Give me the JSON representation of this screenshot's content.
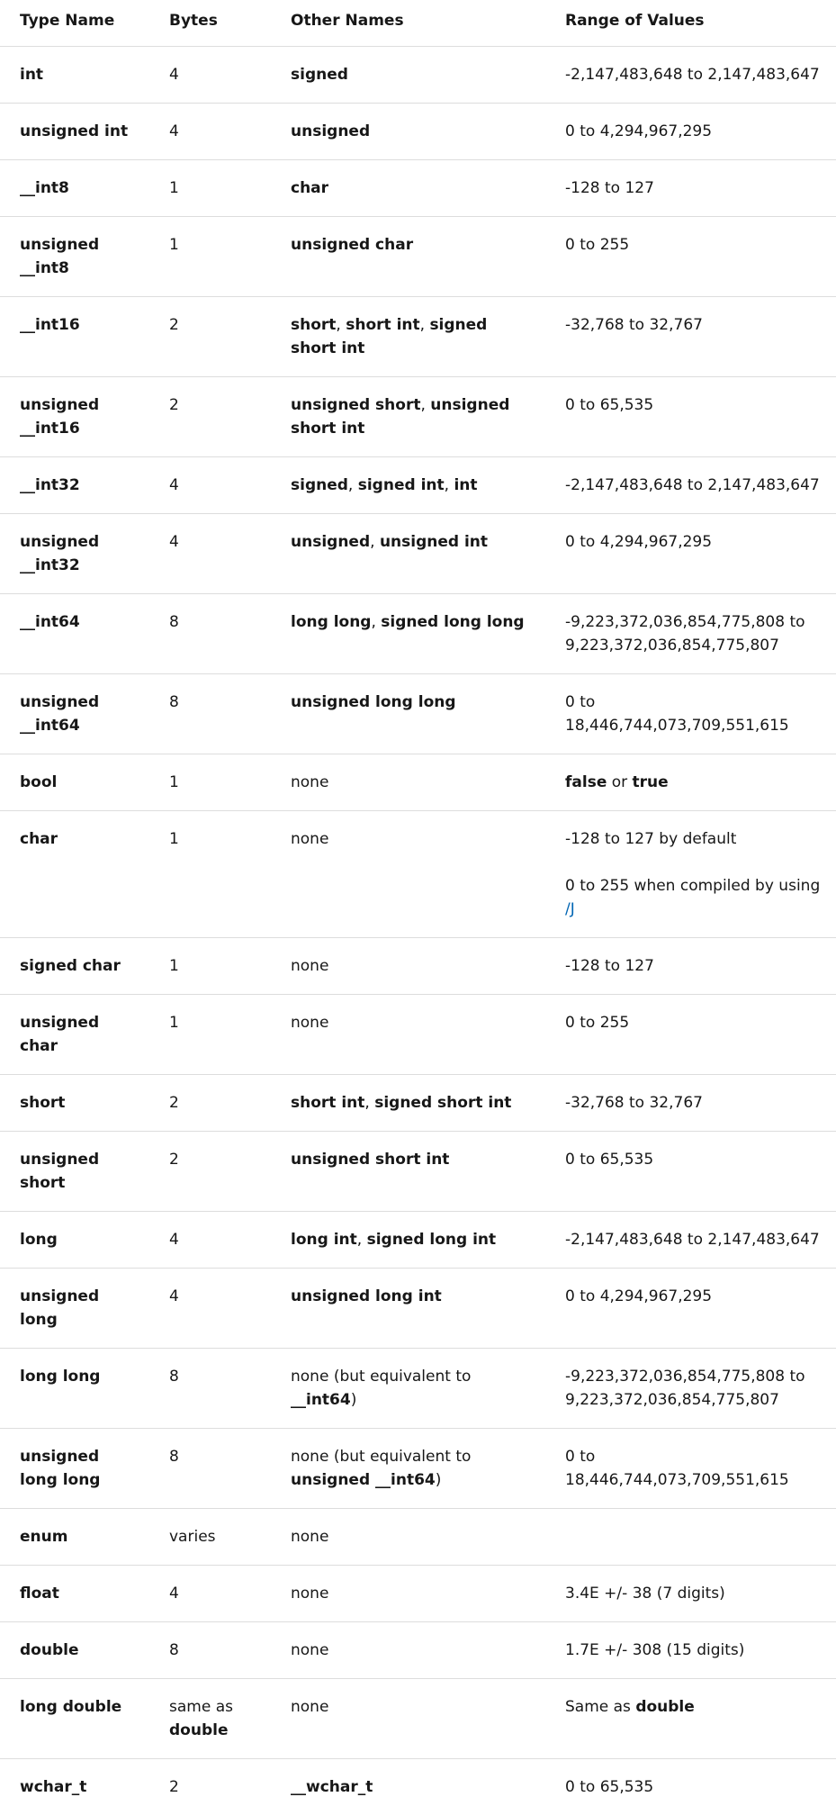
{
  "headers": [
    "Type Name",
    "Bytes",
    "Other Names",
    "Range of Values"
  ],
  "rows": [
    {
      "type": "int",
      "bytes": "4",
      "other": [
        {
          "t": "signed",
          "b": true
        }
      ],
      "range": [
        [
          {
            "t": "-2,147,483,648 to 2,147,483,647"
          }
        ]
      ]
    },
    {
      "type": "unsigned int",
      "bytes": "4",
      "other": [
        {
          "t": "unsigned",
          "b": true
        }
      ],
      "range": [
        [
          {
            "t": "0 to 4,294,967,295"
          }
        ]
      ]
    },
    {
      "type": "__int8",
      "bytes": "1",
      "other": [
        {
          "t": "char",
          "b": true
        }
      ],
      "range": [
        [
          {
            "t": "-128 to 127"
          }
        ]
      ]
    },
    {
      "type": "unsigned __int8",
      "bytes": "1",
      "other": [
        {
          "t": "unsigned char",
          "b": true
        }
      ],
      "range": [
        [
          {
            "t": "0 to 255"
          }
        ]
      ]
    },
    {
      "type": "__int16",
      "bytes": "2",
      "other": [
        {
          "t": "short",
          "b": true
        },
        {
          "t": ", "
        },
        {
          "t": "short int",
          "b": true
        },
        {
          "t": ", "
        },
        {
          "t": "signed short int",
          "b": true
        }
      ],
      "range": [
        [
          {
            "t": "-32,768 to 32,767"
          }
        ]
      ]
    },
    {
      "type": "unsigned __int16",
      "bytes": "2",
      "other": [
        {
          "t": "unsigned short",
          "b": true
        },
        {
          "t": ", "
        },
        {
          "t": "unsigned short int",
          "b": true
        }
      ],
      "range": [
        [
          {
            "t": "0 to 65,535"
          }
        ]
      ]
    },
    {
      "type": "__int32",
      "bytes": "4",
      "other": [
        {
          "t": "signed",
          "b": true
        },
        {
          "t": ", "
        },
        {
          "t": "signed int",
          "b": true
        },
        {
          "t": ", "
        },
        {
          "t": "int",
          "b": true
        }
      ],
      "range": [
        [
          {
            "t": "-2,147,483,648 to 2,147,483,647"
          }
        ]
      ]
    },
    {
      "type": "unsigned __int32",
      "bytes": "4",
      "other": [
        {
          "t": "unsigned",
          "b": true
        },
        {
          "t": ", "
        },
        {
          "t": "unsigned int",
          "b": true
        }
      ],
      "range": [
        [
          {
            "t": "0 to 4,294,967,295"
          }
        ]
      ]
    },
    {
      "type": "__int64",
      "bytes": "8",
      "other": [
        {
          "t": "long long",
          "b": true
        },
        {
          "t": ", "
        },
        {
          "t": "signed long long",
          "b": true
        }
      ],
      "range": [
        [
          {
            "t": "-9,223,372,036,854,775,808 to 9,223,372,036,854,775,807"
          }
        ]
      ]
    },
    {
      "type": "unsigned __int64",
      "bytes": "8",
      "other": [
        {
          "t": "unsigned long long",
          "b": true
        }
      ],
      "range": [
        [
          {
            "t": "0 to 18,446,744,073,709,551,615"
          }
        ]
      ]
    },
    {
      "type": "bool",
      "bytes": "1",
      "other": [
        {
          "t": "none"
        }
      ],
      "range": [
        [
          {
            "t": "false",
            "b": true
          },
          {
            "t": " or "
          },
          {
            "t": "true",
            "b": true
          }
        ]
      ]
    },
    {
      "type": "char",
      "bytes": "1",
      "other": [
        {
          "t": "none"
        }
      ],
      "range": [
        [
          {
            "t": "-128 to 127 by default"
          }
        ],
        [
          {
            "t": "0 to 255 when compiled by using "
          },
          {
            "t": "/J",
            "link": true
          }
        ]
      ]
    },
    {
      "type": "signed char",
      "bytes": "1",
      "other": [
        {
          "t": "none"
        }
      ],
      "range": [
        [
          {
            "t": "-128 to 127"
          }
        ]
      ]
    },
    {
      "type": "unsigned char",
      "bytes": "1",
      "other": [
        {
          "t": "none"
        }
      ],
      "range": [
        [
          {
            "t": "0 to 255"
          }
        ]
      ]
    },
    {
      "type": "short",
      "bytes": "2",
      "other": [
        {
          "t": "short int",
          "b": true
        },
        {
          "t": ", "
        },
        {
          "t": "signed short int",
          "b": true
        }
      ],
      "range": [
        [
          {
            "t": "-32,768 to 32,767"
          }
        ]
      ]
    },
    {
      "type": "unsigned short",
      "bytes": "2",
      "other": [
        {
          "t": "unsigned short int",
          "b": true
        }
      ],
      "range": [
        [
          {
            "t": "0 to 65,535"
          }
        ]
      ]
    },
    {
      "type": "long",
      "bytes": "4",
      "other": [
        {
          "t": "long int",
          "b": true
        },
        {
          "t": ", "
        },
        {
          "t": "signed long int",
          "b": true
        }
      ],
      "range": [
        [
          {
            "t": "-2,147,483,648 to 2,147,483,647"
          }
        ]
      ]
    },
    {
      "type": "unsigned long",
      "bytes": "4",
      "other": [
        {
          "t": "unsigned long int",
          "b": true
        }
      ],
      "range": [
        [
          {
            "t": "0 to 4,294,967,295"
          }
        ]
      ]
    },
    {
      "type": "long long",
      "bytes": "8",
      "other": [
        {
          "t": "none (but equivalent to "
        },
        {
          "t": "__int64",
          "b": true
        },
        {
          "t": ")"
        }
      ],
      "range": [
        [
          {
            "t": "-9,223,372,036,854,775,808 to 9,223,372,036,854,775,807"
          }
        ]
      ]
    },
    {
      "type": "unsigned long long",
      "bytes": "8",
      "other": [
        {
          "t": "none (but equivalent to "
        },
        {
          "t": "unsigned __int64",
          "b": true
        },
        {
          "t": ")"
        }
      ],
      "range": [
        [
          {
            "t": "0 to 18,446,744,073,709,551,615"
          }
        ]
      ]
    },
    {
      "type": "enum",
      "bytes": "varies",
      "other": [
        {
          "t": "none"
        }
      ],
      "range": []
    },
    {
      "type": "float",
      "bytes": "4",
      "other": [
        {
          "t": "none"
        }
      ],
      "range": [
        [
          {
            "t": "3.4E +/- 38 (7 digits)"
          }
        ]
      ]
    },
    {
      "type": "double",
      "bytes": "8",
      "other": [
        {
          "t": "none"
        }
      ],
      "range": [
        [
          {
            "t": "1.7E +/- 308 (15 digits)"
          }
        ]
      ]
    },
    {
      "type": "long double",
      "bytes": [
        {
          "t": "same as "
        },
        {
          "t": "double",
          "b": true
        }
      ],
      "other": [
        {
          "t": "none"
        }
      ],
      "range": [
        [
          {
            "t": "Same as "
          },
          {
            "t": "double",
            "b": true
          }
        ]
      ]
    },
    {
      "type": "wchar_t",
      "bytes": "2",
      "other": [
        {
          "t": "__wchar_t",
          "b": true
        }
      ],
      "range": [
        [
          {
            "t": "0 to 65,535"
          }
        ]
      ]
    }
  ],
  "colors": {
    "text": "#171717",
    "border": "#dddddd",
    "link": "#0065b3"
  }
}
